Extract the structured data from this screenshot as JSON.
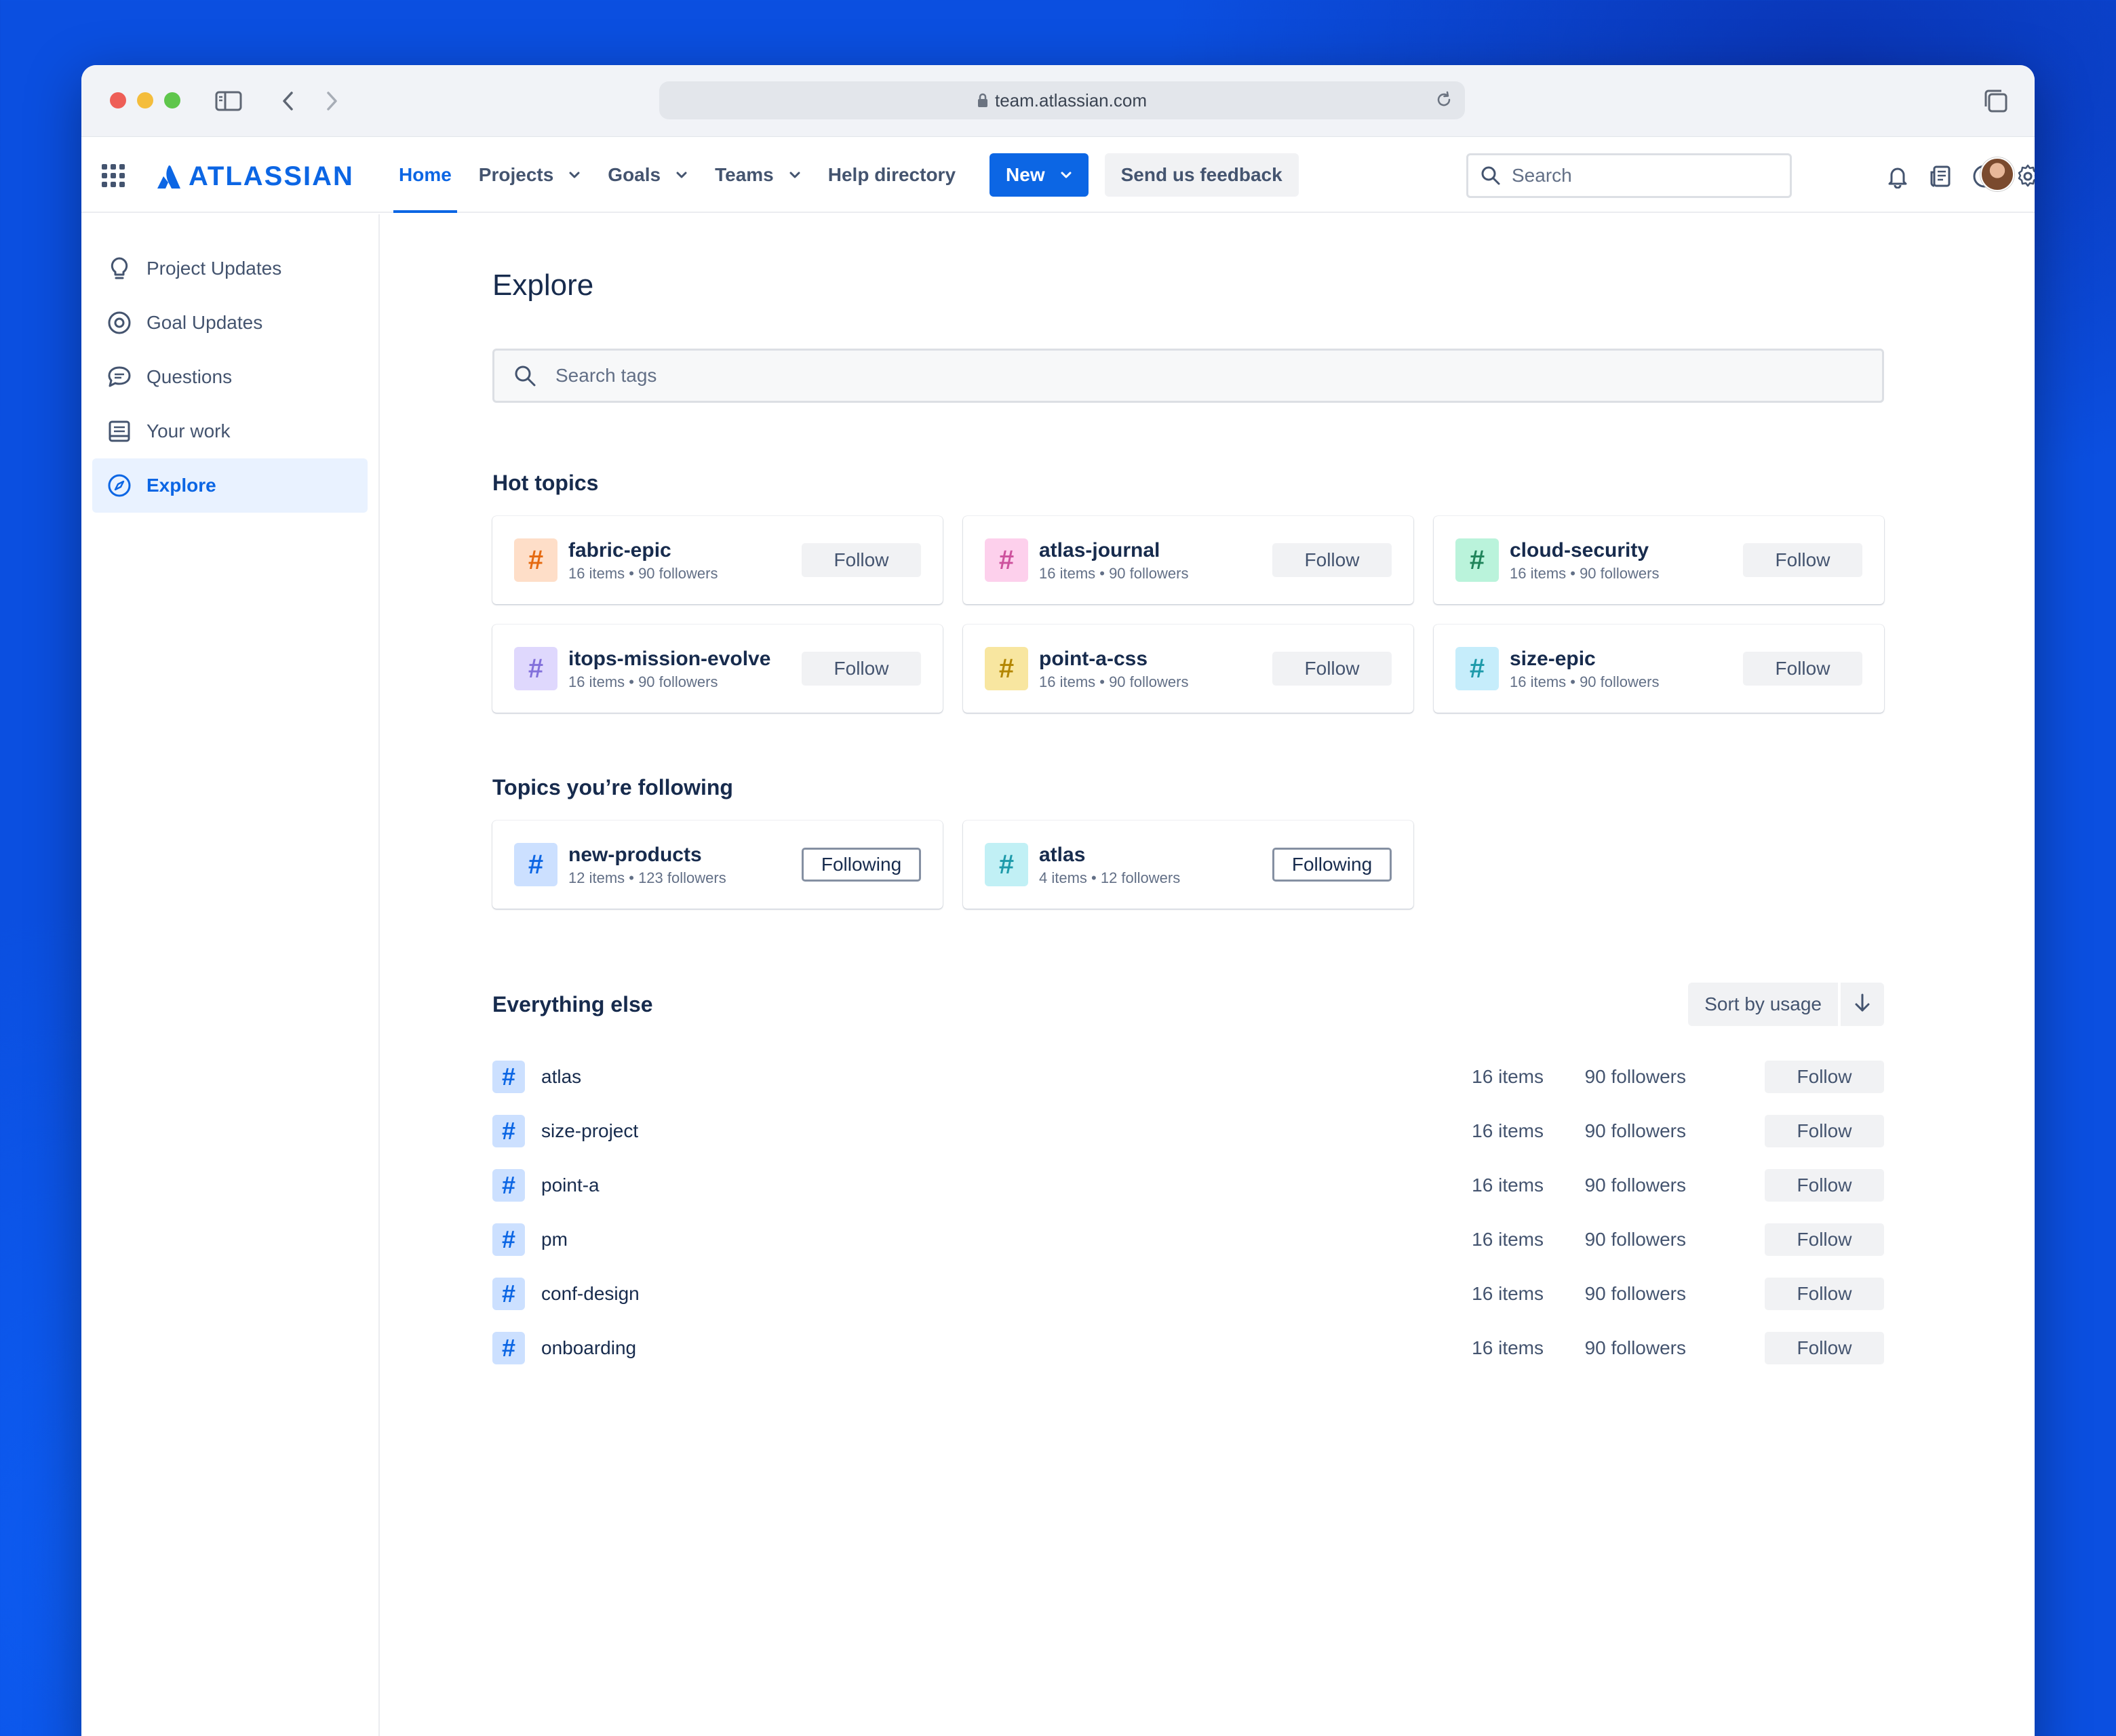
{
  "browser": {
    "url": "team.atlassian.com"
  },
  "header": {
    "logo_text": "ATLASSIAN",
    "nav": [
      {
        "label": "Home"
      },
      {
        "label": "Projects"
      },
      {
        "label": "Goals"
      },
      {
        "label": "Teams"
      },
      {
        "label": "Help directory"
      }
    ],
    "new_label": "New",
    "feedback_label": "Send us feedback",
    "search_placeholder": "Search"
  },
  "sidebar": {
    "items": [
      {
        "label": "Project Updates",
        "icon": "lightbulb-icon"
      },
      {
        "label": "Goal Updates",
        "icon": "target-icon"
      },
      {
        "label": "Questions",
        "icon": "chat-icon"
      },
      {
        "label": "Your work",
        "icon": "document-icon"
      },
      {
        "label": "Explore",
        "icon": "compass-icon",
        "active": true
      }
    ]
  },
  "main": {
    "title": "Explore",
    "search_placeholder": "Search tags",
    "hot_topics": {
      "title": "Hot topics",
      "cards": [
        {
          "name": "fabric-epic",
          "meta": "16 items • 90 followers",
          "button": "Follow",
          "hash": "#",
          "bg": "#fedec8",
          "fg": "#e56910"
        },
        {
          "name": "atlas-journal",
          "meta": "16 items • 90 followers",
          "button": "Follow",
          "hash": "#",
          "bg": "#fdd0ec",
          "fg": "#cd519d"
        },
        {
          "name": "cloud-security",
          "meta": "16 items • 90 followers",
          "button": "Follow",
          "hash": "#",
          "bg": "#baf3db",
          "fg": "#1f845a"
        },
        {
          "name": "itops-mission-evolve",
          "meta": "16 items • 90 followers",
          "button": "Follow",
          "hash": "#",
          "bg": "#dfd8fd",
          "fg": "#8270db"
        },
        {
          "name": "point-a-css",
          "meta": "16 items • 90 followers",
          "button": "Follow",
          "hash": "#",
          "bg": "#f8e6a0",
          "fg": "#b38600"
        },
        {
          "name": "size-epic",
          "meta": "16 items • 90 followers",
          "button": "Follow",
          "hash": "#",
          "bg": "#c6edfb",
          "fg": "#1d9aaa"
        }
      ]
    },
    "following": {
      "title": "Topics you’re following",
      "cards": [
        {
          "name": "new-products",
          "meta": "12 items • 123 followers",
          "button": "Following",
          "hash": "#",
          "bg": "#cce0ff",
          "fg": "#0c66e4"
        },
        {
          "name": "atlas",
          "meta": "4 items • 12 followers",
          "button": "Following",
          "hash": "#",
          "bg": "#c1f0f5",
          "fg": "#1d9aaa"
        }
      ]
    },
    "everything_else": {
      "title": "Everything else",
      "sort_label": "Sort by usage",
      "rows": [
        {
          "name": "atlas",
          "items": "16 items",
          "followers": "90 followers",
          "button": "Follow",
          "hash": "#"
        },
        {
          "name": "size-project",
          "items": "16 items",
          "followers": "90 followers",
          "button": "Follow",
          "hash": "#"
        },
        {
          "name": "point-a",
          "items": "16 items",
          "followers": "90 followers",
          "button": "Follow",
          "hash": "#"
        },
        {
          "name": "pm",
          "items": "16 items",
          "followers": "90 followers",
          "button": "Follow",
          "hash": "#"
        },
        {
          "name": "conf-design",
          "items": "16 items",
          "followers": "90 followers",
          "button": "Follow",
          "hash": "#"
        },
        {
          "name": "onboarding",
          "items": "16 items",
          "followers": "90 followers",
          "button": "Follow",
          "hash": "#"
        }
      ]
    }
  }
}
